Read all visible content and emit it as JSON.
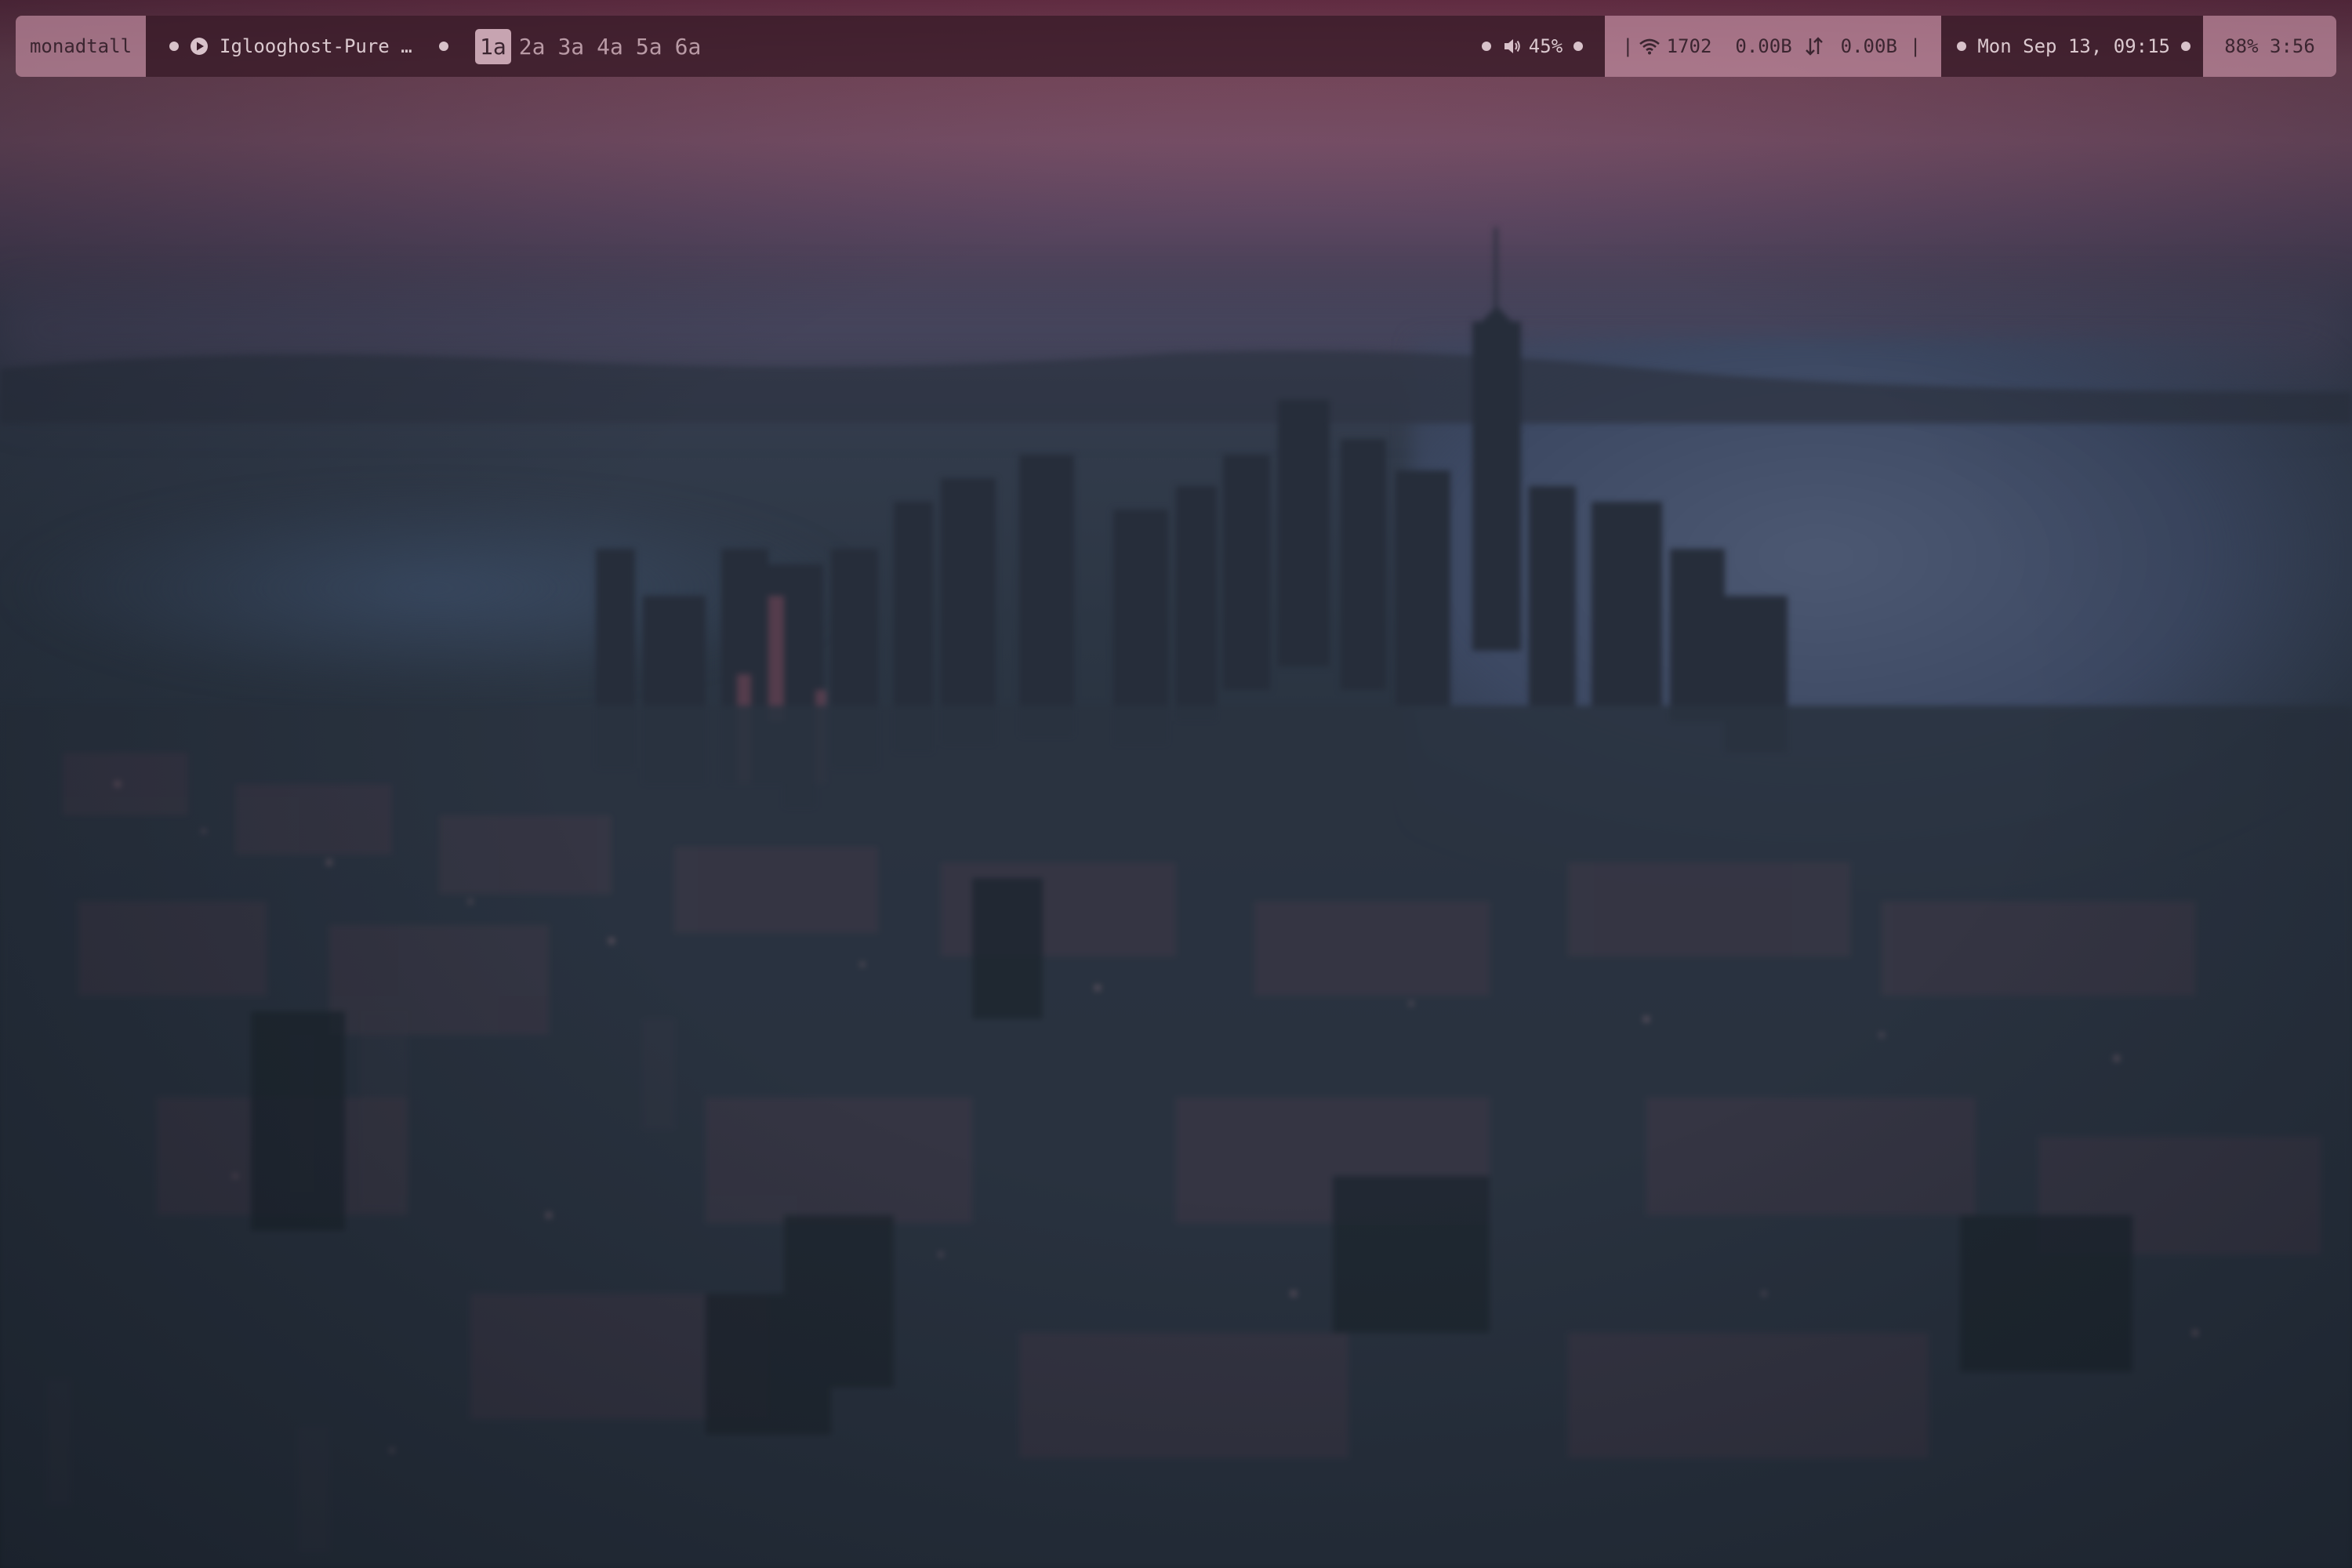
{
  "bar": {
    "layout": "monadtall",
    "window_title": "Iglooghost-Pure G…",
    "groups": [
      {
        "label": "1a",
        "active": true
      },
      {
        "label": "2a",
        "active": false
      },
      {
        "label": "3a",
        "active": false
      },
      {
        "label": "4a",
        "active": false
      },
      {
        "label": "5a",
        "active": false
      },
      {
        "label": "6a",
        "active": false
      }
    ],
    "volume": "45%",
    "separator_left": "|",
    "wifi_signal": "1702",
    "net_down": "0.00B",
    "net_up": "0.00B",
    "separator_right": "|",
    "clock": "Mon Sep 13, 09:15",
    "battery": "88% 3:56"
  },
  "colors": {
    "bar_light": "#c08ca0",
    "bar_dark": "#3a1c2a",
    "text_light": "#dbc9cf",
    "text_dark": "#3b2530",
    "sky_top": "#6e3048",
    "city": "#222c36"
  },
  "icons": {
    "media": "play-icon",
    "volume": "speaker-icon",
    "network": "wifi-icon",
    "traffic": "up-down-arrows-icon"
  }
}
